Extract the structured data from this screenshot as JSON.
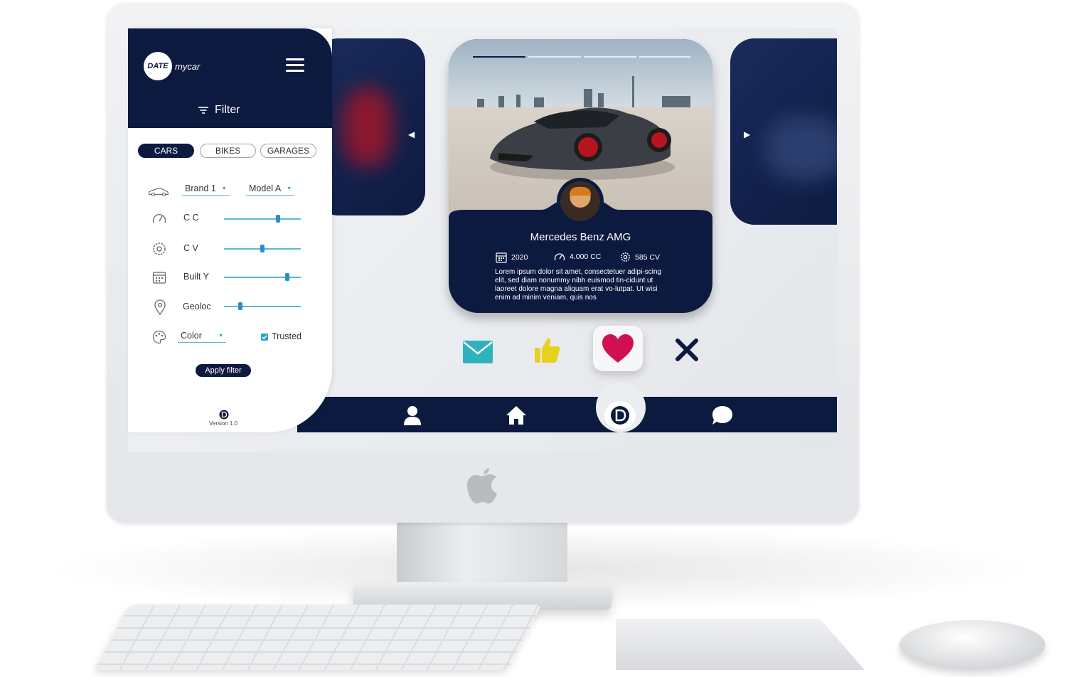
{
  "app": {
    "logo_badge": "DATE",
    "logo_text": "mycar"
  },
  "filter": {
    "title": "Filter",
    "tabs": [
      {
        "label": "CARS",
        "active": true
      },
      {
        "label": "BIKES",
        "active": false
      },
      {
        "label": "GARAGES",
        "active": false
      }
    ],
    "brand": "Brand 1",
    "model": "Model A",
    "sliders": [
      {
        "label": "C C",
        "value": 0.7,
        "icon": "speedometer-icon"
      },
      {
        "label": "C V",
        "value": 0.5,
        "icon": "gear-icon"
      },
      {
        "label": "Built Y",
        "value": 0.82,
        "icon": "calendar-icon"
      },
      {
        "label": "Geoloc",
        "value": 0.21,
        "icon": "location-pin-icon"
      }
    ],
    "color": "Color",
    "trusted_label": "Trusted",
    "trusted_checked": true,
    "apply_label": "Apply filter",
    "version": "Version 1.0"
  },
  "card": {
    "title": "Mercedes Benz AMG",
    "year": "2020",
    "cc": "4.000 CC",
    "cv": "585 CV",
    "description": "Lorem ipsum dolor sit amet, consectetuer adipi-scing elit, sed diam nonummy nibh euismod tin-cidunt ut laoreet dolore magna aliquam erat vo-lutpat. Ut wisi enim ad minim veniam, quis nos",
    "photo_index": 1,
    "photo_count": 4
  },
  "actions": [
    "mail-icon",
    "thumbs-up-icon",
    "heart-icon",
    "close-icon"
  ],
  "nav": [
    "profile-icon",
    "home-icon",
    "date-logo-icon",
    "chat-icon"
  ],
  "colors": {
    "navy": "#0d1a40",
    "accent": "#58b8d6",
    "mail": "#2eb3be",
    "like": "#e5d21c",
    "heart": "#d0104f"
  }
}
